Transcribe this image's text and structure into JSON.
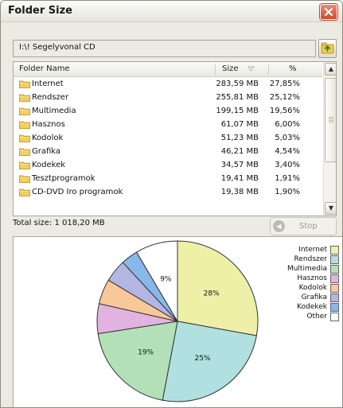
{
  "window": {
    "title": "Folder Size"
  },
  "path": {
    "value": "I:\\! Segelyvonal CD"
  },
  "list": {
    "headers": {
      "name": "Folder Name",
      "size": "Size",
      "pct": "%"
    },
    "rows": [
      {
        "name": "Internet",
        "size": "283,59 MB",
        "pct": "27,85%"
      },
      {
        "name": "Rendszer",
        "size": "255,81 MB",
        "pct": "25,12%"
      },
      {
        "name": "Multimedia",
        "size": "199,15 MB",
        "pct": "19,56%"
      },
      {
        "name": "Hasznos",
        "size": "61,07 MB",
        "pct": "6,00%"
      },
      {
        "name": "Kodolok",
        "size": "51,23 MB",
        "pct": "5,03%"
      },
      {
        "name": "Grafika",
        "size": "46,21 MB",
        "pct": "4,54%"
      },
      {
        "name": "Kodekek",
        "size": "34,57 MB",
        "pct": "3,40%"
      },
      {
        "name": "Tesztprogramok",
        "size": "19,41 MB",
        "pct": "1,91%"
      },
      {
        "name": "CD-DVD Iro programok",
        "size": "19,38 MB",
        "pct": "1,90%"
      }
    ]
  },
  "status": {
    "total": "Total size: 1 018,20 MB",
    "stop_label": "Stop"
  },
  "chart_data": {
    "type": "pie",
    "slices": [
      {
        "name": "Internet",
        "value": 27.85,
        "label": "28%",
        "color": "#eef0a8"
      },
      {
        "name": "Rendszer",
        "value": 25.12,
        "label": "25%",
        "color": "#b0e0e0"
      },
      {
        "name": "Multimedia",
        "value": 19.56,
        "label": "19%",
        "color": "#b3e0b8"
      },
      {
        "name": "Hasznos",
        "value": 6.0,
        "label": "",
        "color": "#e2b3e0"
      },
      {
        "name": "Kodolok",
        "value": 5.03,
        "label": "",
        "color": "#f8c898"
      },
      {
        "name": "Grafika",
        "value": 4.54,
        "label": "",
        "color": "#b3b5e2"
      },
      {
        "name": "Kodekek",
        "value": 3.4,
        "label": "",
        "color": "#88b7e8"
      },
      {
        "name": "Other",
        "value": 8.5,
        "label": "9%",
        "color": "#ffffff"
      }
    ],
    "legend_position": "top-right"
  }
}
